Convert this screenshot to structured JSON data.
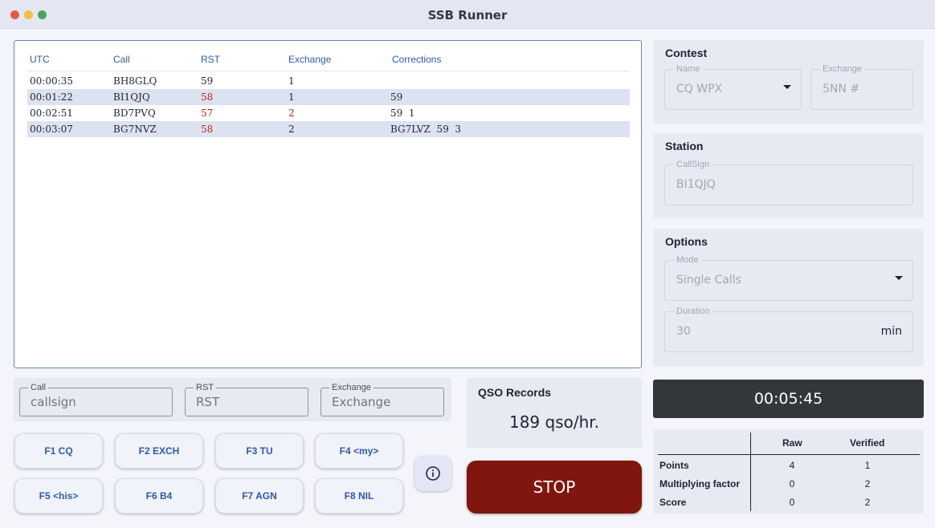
{
  "window": {
    "title": "SSB Runner"
  },
  "log": {
    "columns": [
      "UTC",
      "Call",
      "RST",
      "Exchange",
      "Corrections"
    ],
    "rows": [
      {
        "utc": "00:00:35",
        "call": "BH8GLQ",
        "rst": "59",
        "exchange": "1",
        "corrections": ""
      },
      {
        "utc": "00:01:22",
        "call": "BI1QJQ",
        "rst": "58",
        "exchange": "1",
        "corrections": "59"
      },
      {
        "utc": "00:02:51",
        "call": "BD7PVQ",
        "rst": "57",
        "exchange": "2",
        "corrections": "59  1"
      },
      {
        "utc": "00:03:07",
        "call": "BG7NVZ",
        "rst": "58",
        "exchange": "2",
        "corrections": "BG7LVZ  59  3"
      }
    ],
    "error_color": "#b3261e"
  },
  "entry": {
    "call": {
      "label": "Call",
      "placeholder": "callsign"
    },
    "rst": {
      "label": "RST",
      "placeholder": "RST"
    },
    "exchange": {
      "label": "Exchange",
      "placeholder": "Exchange"
    }
  },
  "fkeys": [
    "F1 CQ",
    "F2 EXCH",
    "F3 TU",
    "F4 <my>",
    "F5 <his>",
    "F6 B4",
    "F7 AGN",
    "F8 NIL"
  ],
  "info_icon": "info-circle-icon",
  "qso_records": {
    "heading": "QSO Records",
    "value": "189 qso/hr."
  },
  "stop_label": "STOP",
  "stop_color": "#80160d",
  "contest": {
    "heading": "Contest",
    "name_label": "Name",
    "name_value": "CQ WPX",
    "exchange_label": "Exchange",
    "exchange_value": "5NN #"
  },
  "station": {
    "heading": "Station",
    "callsign_label": "CallSign",
    "callsign_value": "BI1QJQ"
  },
  "options": {
    "heading": "Options",
    "mode_label": "Mode",
    "mode_value": "Single Calls",
    "duration_label": "Duration",
    "duration_value": "30",
    "duration_unit": "min"
  },
  "timer": "00:05:45",
  "score": {
    "col_raw": "Raw",
    "col_verified": "Verified",
    "rows": [
      {
        "label": "Points",
        "raw": "4",
        "verified": "1"
      },
      {
        "label": "Multiplying factor",
        "raw": "0",
        "verified": "2"
      },
      {
        "label": "Score",
        "raw": "0",
        "verified": "2"
      }
    ]
  }
}
